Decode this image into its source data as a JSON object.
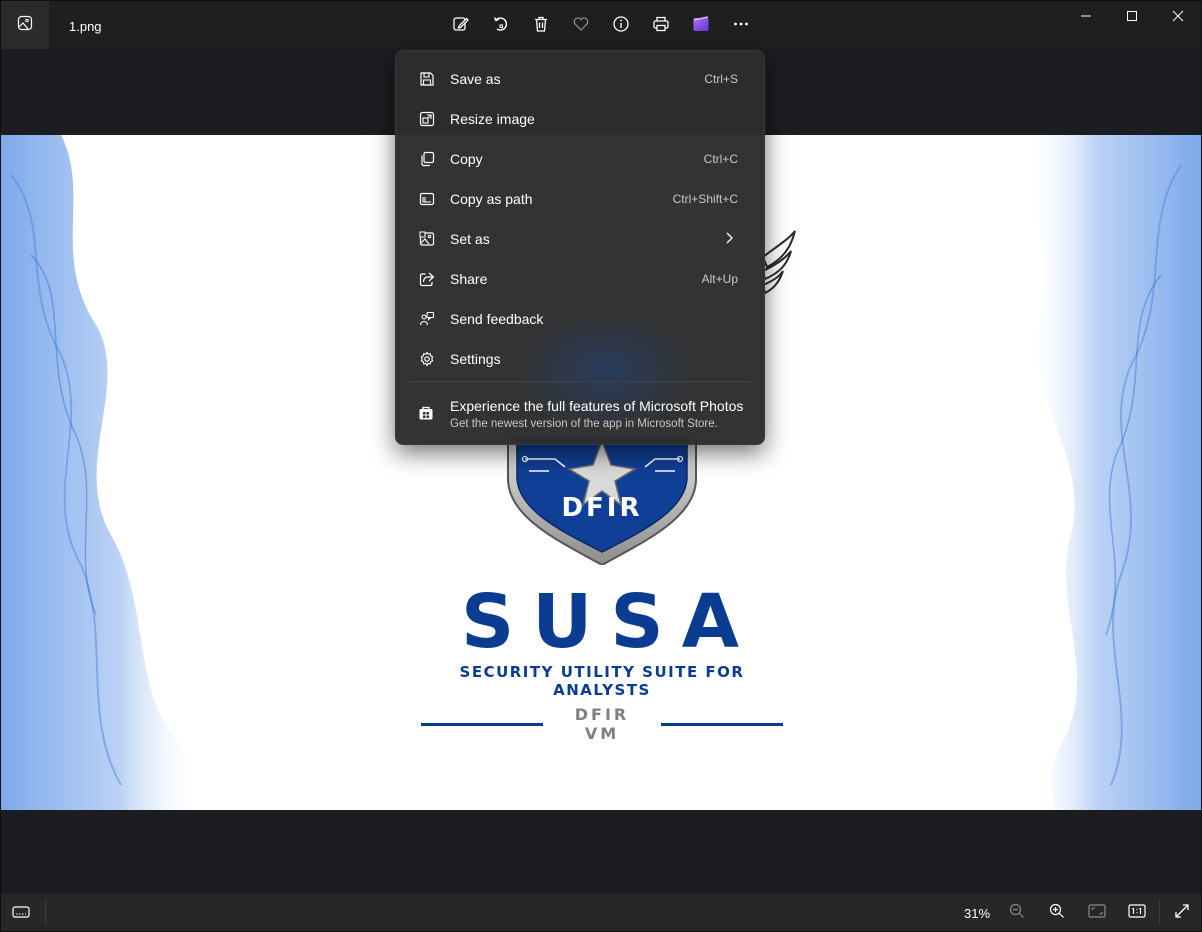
{
  "window": {
    "filename": "1.png"
  },
  "toolbar": {
    "buttons": [
      "edit-icon",
      "rotate-icon",
      "delete-icon",
      "favorite-icon",
      "info-icon",
      "print-icon",
      "clipchamp-icon",
      "more-icon"
    ]
  },
  "image": {
    "logo_text": "DFIR",
    "title": "SUSA",
    "subtitle": "SECURITY UTILITY SUITE FOR ANALYSTS",
    "tagline": "DFIR VM",
    "colors": {
      "brand_blue": "#0a3d91",
      "gray": "#808080"
    }
  },
  "menu": {
    "items": [
      {
        "label": "Save as",
        "shortcut": "Ctrl+S",
        "icon": "save-icon"
      },
      {
        "label": "Resize image",
        "shortcut": "",
        "icon": "resize-icon"
      },
      {
        "label": "Copy",
        "shortcut": "Ctrl+C",
        "icon": "copy-icon"
      },
      {
        "label": "Copy as path",
        "shortcut": "Ctrl+Shift+C",
        "icon": "copy-path-icon"
      },
      {
        "label": "Set as",
        "shortcut": "",
        "icon": "set-as-icon",
        "submenu": true
      },
      {
        "label": "Share",
        "shortcut": "Alt+Up",
        "icon": "share-icon"
      },
      {
        "label": "Send feedback",
        "shortcut": "",
        "icon": "feedback-icon"
      },
      {
        "label": "Settings",
        "shortcut": "",
        "icon": "gear-icon"
      }
    ],
    "promo": {
      "title": "Experience the full features of Microsoft Photos",
      "subtitle": "Get the newest version of the app in Microsoft Store.",
      "icon": "store-icon"
    }
  },
  "statusbar": {
    "zoom": "31%"
  }
}
